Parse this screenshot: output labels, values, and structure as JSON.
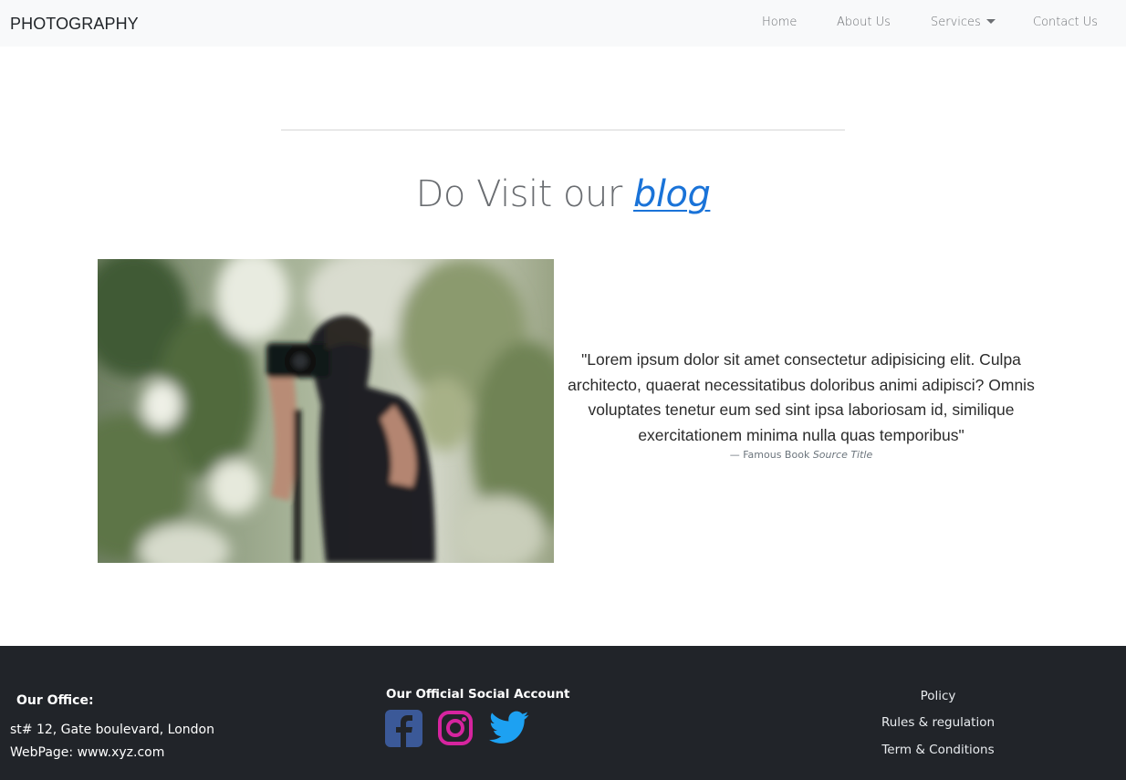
{
  "navbar": {
    "brand": "PHOTOGRAPHY",
    "links": {
      "home": "Home",
      "about": "About Us",
      "services": "Services",
      "contact": "Contact Us"
    }
  },
  "main": {
    "heading_prefix": "Do Visit our ",
    "heading_link": "blog",
    "quote": "\"Lorem ipsum dolor sit amet consectetur adipisicing elit. Culpa architecto, quaerat necessitatibus doloribus animi adipisci? Omnis voluptates tenetur eum sed sint ipsa laboriosam id, similique exercitationem minima nulla quas temporibus\"",
    "quote_attribution": "— Famous Book ",
    "quote_source": "Source Title"
  },
  "footer": {
    "office": {
      "title": "Our Office:",
      "address": "st# 12, Gate boulevard, London",
      "webpage": "WebPage: www.xyz.com"
    },
    "social": {
      "title": "Our Official Social Account",
      "icons": [
        "facebook-icon",
        "instagram-icon",
        "twitter-icon"
      ]
    },
    "links": {
      "policy": "Policy",
      "rules": "Rules & regulation",
      "terms": "Term & Conditions"
    }
  },
  "colors": {
    "navbar_bg": "#f8f9fa",
    "footer_bg": "#212429",
    "link_blue": "#1a73d8",
    "facebook": "#3b5998",
    "instagram": "#d6249f",
    "twitter": "#1da1f2"
  }
}
